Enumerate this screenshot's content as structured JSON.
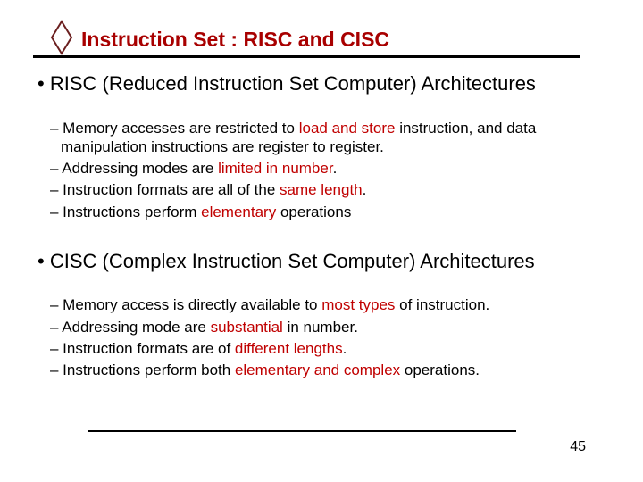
{
  "title": "Instruction Set : RISC and CISC",
  "sections": [
    {
      "heading": "• RISC (Reduced Instruction Set Computer) Architectures",
      "points": [
        {
          "pre": "– Memory accesses are restricted to ",
          "em": "load and store",
          "post": " instruction, and data manipulation instructions are register to register."
        },
        {
          "pre": "– Addressing modes are ",
          "em": "limited in number",
          "post": "."
        },
        {
          "pre": "– Instruction formats are all of the ",
          "em": "same length",
          "post": "."
        },
        {
          "pre": "– Instructions perform ",
          "em": "elementary",
          "post": " operations"
        }
      ]
    },
    {
      "heading": "• CISC (Complex Instruction Set Computer) Architectures",
      "points": [
        {
          "pre": "– Memory access is directly available to ",
          "em": "most types",
          "post": " of instruction."
        },
        {
          "pre": "– Addressing mode are ",
          "em": "substantial",
          "post": " in number."
        },
        {
          "pre": "– Instruction formats are of ",
          "em": "different lengths",
          "post": "."
        },
        {
          "pre": "– Instructions perform both ",
          "em": "elementary and complex",
          "post": " operations."
        }
      ]
    }
  ],
  "page_number": "45",
  "colors": {
    "accent": "#a80000",
    "emphasis": "#c00000"
  }
}
